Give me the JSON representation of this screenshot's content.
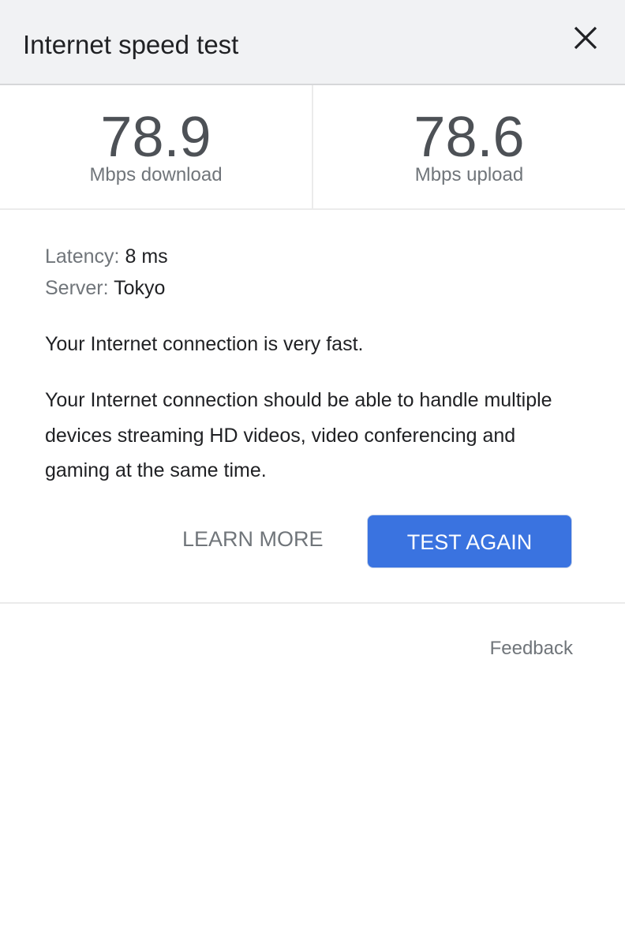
{
  "header": {
    "title": "Internet speed test",
    "close_icon": "close-icon"
  },
  "results": {
    "download": {
      "value": "78.9",
      "unit": "Mbps download"
    },
    "upload": {
      "value": "78.6",
      "unit": "Mbps upload"
    }
  },
  "details": {
    "latency_label": "Latency:",
    "latency_value": "8 ms",
    "server_label": "Server:",
    "server_value": "Tokyo"
  },
  "summary": "Your Internet connection is very fast.",
  "description": "Your Internet connection should be able to handle multiple devices streaming HD videos, video conferencing and gaming at the same time.",
  "actions": {
    "learn_more": "LEARN MORE",
    "test_again": "TEST AGAIN"
  },
  "footer": {
    "feedback": "Feedback"
  },
  "colors": {
    "accent": "#3a73e0",
    "header_bg": "#f1f2f4",
    "number": "#4d5156",
    "muted": "#70757a"
  }
}
